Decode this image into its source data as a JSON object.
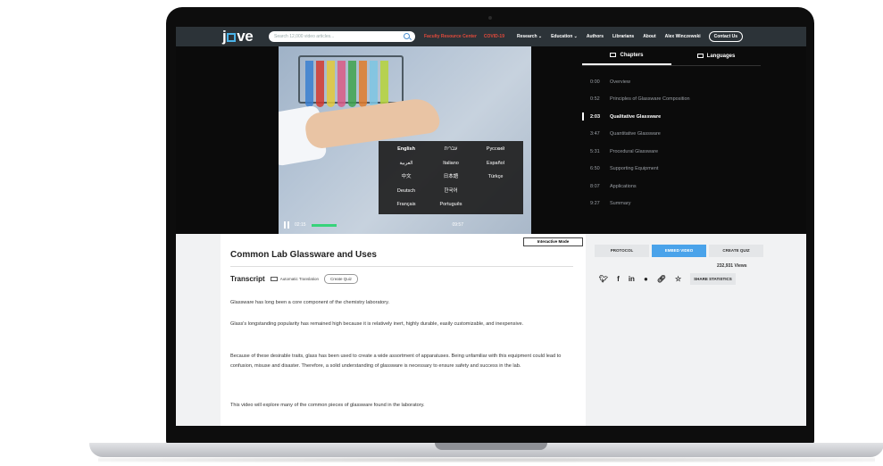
{
  "nav": {
    "logo": "j□ve",
    "search_placeholder": "Search 12,000 video articles...",
    "faculty_link": "Faculty Resource Center",
    "covid_link": "COVID-19",
    "research": "Research ⌄",
    "education": "Education ⌄",
    "authors": "Authors",
    "librarians": "Librarians",
    "about": "About",
    "user": "Alex Winczewski",
    "contact": "Contact Us"
  },
  "video": {
    "languages": [
      "English",
      "עברית",
      "Русский",
      "العربية",
      "Italiano",
      "Español",
      "中文",
      "日本語",
      "Türkçe",
      "Deutsch",
      "한국어",
      "",
      "Français",
      "Português",
      ""
    ],
    "time_left": "02:15",
    "time_right": "09:57"
  },
  "chapters": {
    "tab_chapters": "Chapters",
    "tab_languages": "Languages",
    "items": [
      {
        "time": "0:00",
        "title": "Overview"
      },
      {
        "time": "0:52",
        "title": "Principles of Glassware Composition"
      },
      {
        "time": "2:03",
        "title": "Qualitative Glassware"
      },
      {
        "time": "3:47",
        "title": "Quantitative Glassware"
      },
      {
        "time": "5:31",
        "title": "Procedural Glassware"
      },
      {
        "time": "6:50",
        "title": "Supporting Equipment"
      },
      {
        "time": "8:07",
        "title": "Applications"
      },
      {
        "time": "9:27",
        "title": "Summary"
      }
    ],
    "current_index": 2
  },
  "article": {
    "interactive_mode": "Interactive Mode",
    "title": "Common Lab Glassware and Uses",
    "transcript": "Transcript",
    "auto_translation": "Automatic Translation",
    "create_quiz": "Create Quiz",
    "paragraphs": [
      "Glassware has long been a core component of the chemistry laboratory.",
      "Glass's longstanding popularity has remained high because it is relatively inert, highly durable, easily customizable, and inexpensive.",
      "Because of these desirable traits, glass has been used to create a wide assortment of apparatuses. Being unfamiliar with this equipment could lead to confusion, misuse and disaster. Therefore, a solid understanding of glassware is necessary to ensure safety and success in the lab.",
      "This video will explore many of the common pieces of glassware found in the laboratory."
    ]
  },
  "side": {
    "protocol": "PROTOCOL",
    "embed_video": "EMBED VIDEO",
    "create_quiz": "CREATE QUIZ",
    "views": "232,931 Views",
    "share_stats": "SHARE STATISTICS",
    "share_icons": [
      "twitter-icon",
      "facebook-icon",
      "linkedin-icon",
      "wechat-icon",
      "link-icon",
      "star-icon"
    ]
  }
}
